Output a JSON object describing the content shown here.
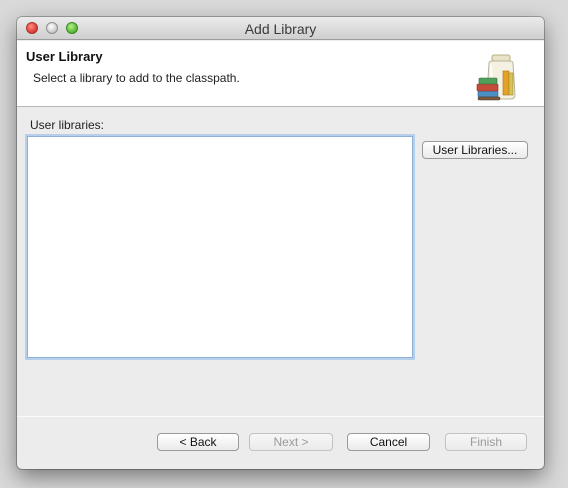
{
  "window": {
    "title": "Add Library"
  },
  "banner": {
    "title": "User Library",
    "message": "Select a library to add to the classpath.",
    "icon": "library-jar-books-icon"
  },
  "main": {
    "list_label": "User libraries:",
    "list_items": [],
    "user_libraries_button": "User Libraries..."
  },
  "footer": {
    "back_label": "< Back",
    "next_label": "Next >",
    "cancel_label": "Cancel",
    "finish_label": "Finish",
    "next_enabled": false,
    "finish_enabled": false
  }
}
